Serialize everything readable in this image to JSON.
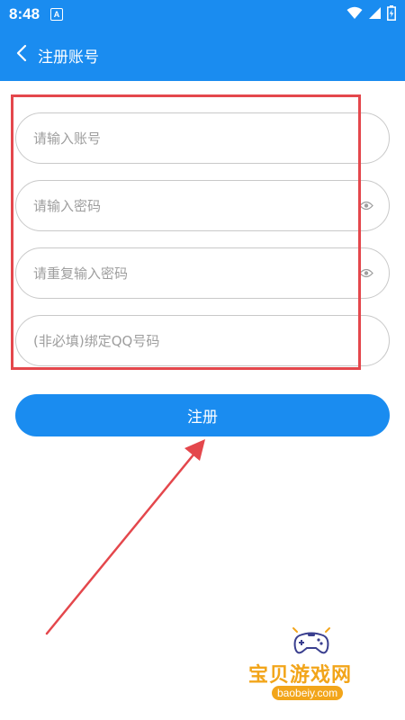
{
  "status_bar": {
    "time": "8:48",
    "app_icon_letter": "A",
    "icons": [
      "wifi-icon",
      "signal-icon",
      "battery-icon"
    ]
  },
  "app_bar": {
    "back_icon": "chevron-left-icon",
    "title": "注册账号"
  },
  "form": {
    "account": {
      "placeholder": "请输入账号",
      "value": ""
    },
    "password": {
      "placeholder": "请输入密码",
      "value": "",
      "icon": "eye-icon"
    },
    "confirm_password": {
      "placeholder": "请重复输入密码",
      "value": "",
      "icon": "eye-icon"
    },
    "qq": {
      "placeholder": "(非必填)绑定QQ号码",
      "value": ""
    }
  },
  "register_button": {
    "label": "注册"
  },
  "colors": {
    "primary": "#1a8cf0",
    "annotation": "#e4474c",
    "watermark": "#f2a51a"
  },
  "watermark": {
    "title": "宝贝游戏网",
    "domain": "baobeiy.com"
  }
}
